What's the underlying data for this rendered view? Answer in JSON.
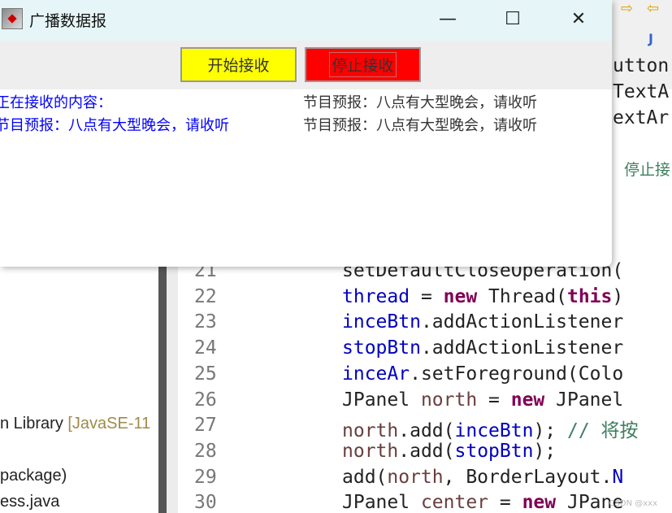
{
  "window": {
    "title": "广播数据报",
    "controls": {
      "minimize": "—",
      "maximize": "☐",
      "close": "✕"
    }
  },
  "toolbar": {
    "start_label": "开始接收",
    "stop_label": "停止接收",
    "start_color": "#ffff00",
    "stop_color": "#ff0000"
  },
  "receiving_area": {
    "lines": [
      "正在接收的内容：",
      "节目预报：八点有大型晚会，请收听"
    ],
    "color": "#0000ff"
  },
  "received_area": {
    "lines": [
      "节目预报：八点有大型晚会，请收听",
      "节目预报：八点有大型晚会，请收听"
    ]
  },
  "ide": {
    "tree_items": [
      {
        "text": "n Library ",
        "extra": "[JavaSE-11"
      },
      {
        "text": " package)",
        "extra": ""
      },
      {
        "text": "ess.java",
        "extra": ""
      }
    ],
    "right_fragments": [
      "utton",
      "TextA",
      "extAr"
    ],
    "right_comment": "停止接",
    "code_lines": [
      {
        "n": "21",
        "tokens": [
          [
            "setDefaultCloseOperation(",
            ""
          ]
        ]
      },
      {
        "n": "22",
        "tokens": [
          [
            "thread",
            "fld"
          ],
          [
            " = ",
            ""
          ],
          [
            "new",
            "kw"
          ],
          [
            " Thread(",
            ""
          ],
          [
            "this",
            "kw"
          ],
          [
            ")",
            ""
          ]
        ]
      },
      {
        "n": "23",
        "tokens": [
          [
            "inceBtn",
            "fld"
          ],
          [
            ".addActionListener",
            ""
          ]
        ]
      },
      {
        "n": "24",
        "tokens": [
          [
            "stopBtn",
            "fld"
          ],
          [
            ".addActionListener",
            ""
          ]
        ]
      },
      {
        "n": "25",
        "tokens": [
          [
            "inceAr",
            "fld"
          ],
          [
            ".setForeground(Colo",
            ""
          ]
        ]
      },
      {
        "n": "26",
        "tokens": [
          [
            "JPanel ",
            ""
          ],
          [
            "north",
            "var"
          ],
          [
            " = ",
            ""
          ],
          [
            "new",
            "kw"
          ],
          [
            " JPanel",
            ""
          ]
        ]
      },
      {
        "n": "27",
        "tokens": [
          [
            "north",
            "var"
          ],
          [
            ".add(",
            ""
          ],
          [
            "inceBtn",
            "fld"
          ],
          [
            "); ",
            ""
          ],
          [
            "// 将按",
            "cm"
          ]
        ]
      },
      {
        "n": "28",
        "tokens": [
          [
            "north",
            "var"
          ],
          [
            ".add(",
            ""
          ],
          [
            "stopBtn",
            "fld"
          ],
          [
            ");",
            ""
          ]
        ]
      },
      {
        "n": "29",
        "tokens": [
          [
            "add(",
            ""
          ],
          [
            "north",
            "var"
          ],
          [
            ", BorderLayout.",
            ""
          ],
          [
            "N",
            "fld"
          ]
        ]
      },
      {
        "n": "30",
        "tokens": [
          [
            "JPanel ",
            ""
          ],
          [
            "center",
            "var"
          ],
          [
            " = ",
            ""
          ],
          [
            "new",
            "kw"
          ],
          [
            " JPane",
            ""
          ]
        ]
      }
    ]
  },
  "watermark": "CSDN @xxx"
}
